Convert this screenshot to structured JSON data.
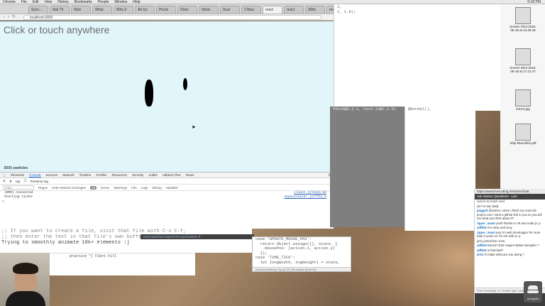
{
  "menubar": {
    "items": [
      "Chrome",
      "File",
      "Edit",
      "View",
      "History",
      "Bookmarks",
      "People",
      "Window",
      "Help"
    ],
    "clock": "5:18 PM"
  },
  "browser": {
    "tabs": [
      "Sync...",
      "Ask Th",
      "Nets",
      "What",
      "Why d",
      "Ab Gc",
      "Picnic",
      "Ovisi",
      "Inbox",
      "Scar",
      "1 Mea",
      "react",
      "react",
      "d3fsr",
      "react",
      "react"
    ],
    "active_tab_index": 11,
    "url": "localhost:3000"
  },
  "page": {
    "headline": "Click or touch anywhere",
    "particle_count": "3000 particles"
  },
  "devtools": {
    "tabs": [
      "Elements",
      "Console",
      "Sources",
      "Network",
      "Timeline",
      "Profiles",
      "Resources",
      "Security",
      "Audits",
      "Adblock Plus",
      "React"
    ],
    "active_tab": "Console",
    "context": "top",
    "preserve_log": "Preserve log",
    "filter_placeholder": "Filter",
    "filter_options": [
      "Regex",
      "Hide network messages"
    ],
    "levels": [
      "All",
      "Errors",
      "Warnings",
      "Info",
      "Logs",
      "Debug",
      "Handled"
    ],
    "logs": [
      {
        "text": "[HMR] connected",
        "source": "client.js?e4c5:53"
      },
      {
        "text": "Starting ticker",
        "source": "AppContainer.js?ffb1:5"
      }
    ],
    "prompt": ">"
  },
  "editor_top": {
    "lines": [
      "",
      "",
      "",
      "",
      "",
      "",
      "2,",
      "1, 1.8);"
    ]
  },
  "gray_panel": {
    "lines": [
      "fetch@2.2.1, core-js@1.2.6)"
    ]
  },
  "code_panel": {
    "lines": [
      "@Normal(),"
    ]
  },
  "editor_lower": {
    "lines": [
      "case 'UPDATE_MOUSE_POS':",
      "  return Object.assign({}, state, {",
      "    mousePos: [action.x, action.y]",
      "  });",
      "case 'TIME_TICK':",
      "  let {svgWidth, svgHeight} = state,"
    ],
    "status": "reducers/index.js  Top (2,27)  Git:master  [Eval Sr]"
  },
  "ide_bar": "react-particles-experiment git:(master) ✗",
  "terminal": {
    "lines": [
      ";; If you want to create a file, visit that file with C-x C-f,",
      ";; then enter the text in that file's own buffer.",
      "",
      "Trying to smoothly animate 10k+ elements :]"
    ],
    "small_lines": [
      "",
      "",
      "",
      "practice *] Fibro Fill"
    ]
  },
  "desktop_files": [
    {
      "name": "Screen Shot 2016-06-18 at 13.28.28"
    },
    {
      "name": "Screen Shot 2016-06-18 at 17.21.47"
    },
    {
      "name": "DSC0.jpg"
    },
    {
      "name": "Ship Munchkin.pdf"
    }
  ],
  "chat": {
    "header": "Ask Swizec Questions · Live",
    "url": "https://www.livecoding.tv/swizec/chat",
    "messages": [
      {
        "user": "",
        "text": "cool is so much cool"
      },
      {
        "user": "",
        "text": "ok? is mac bad)"
      },
      {
        "user": "pegged",
        "text": "@swizec: when i finish my react-d3 project can I send a github link to you so you tell me what you think about it?"
      },
      {
        "user": "ripper_mami",
        "text": "yeah thanks to V8 and node.js :p"
      },
      {
        "user": "adf815",
        "text": "it is easy and sexy"
      },
      {
        "user": "ripper_mami",
        "text": "yep I'm web developper for more than 5 years so I'm OK with js :p"
      },
      {
        "user": "",
        "text": "jerry joined the room."
      },
      {
        "user": "adf815",
        "text": "Doesn't ES6 require Babel transpiler ?"
      },
      {
        "user": "adf815",
        "text": "is that bad?"
      },
      {
        "user": "jerry",
        "text": "hi make what are you doing ?"
      }
    ],
    "input_placeholder": "Your message or / Inside type code here",
    "footer_label": "Incognito"
  }
}
